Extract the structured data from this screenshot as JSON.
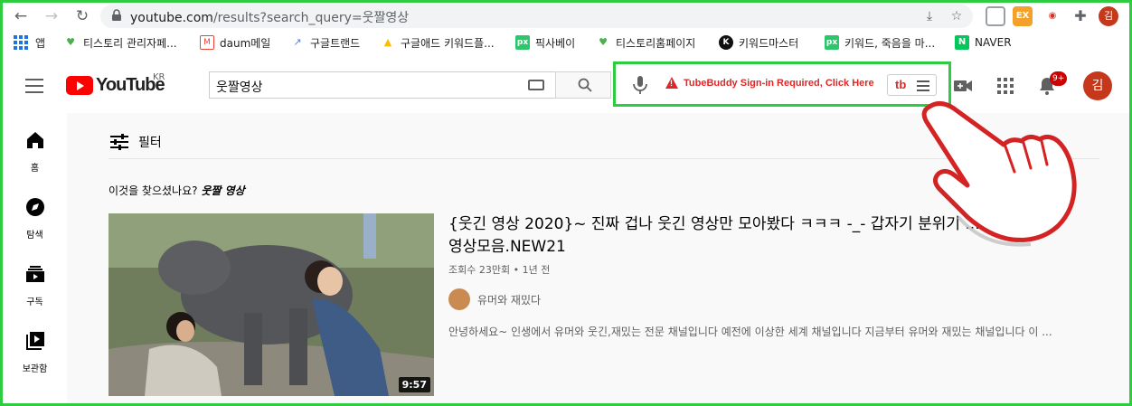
{
  "browser": {
    "url_host": "youtube.com",
    "url_path": "/results?search_query=웃짤영상",
    "extensions": [
      {
        "name": "ext-shield",
        "label": ""
      },
      {
        "name": "ext-ex",
        "label": "EX"
      },
      {
        "name": "ext-red",
        "label": ""
      }
    ],
    "profile_initial": "김"
  },
  "bookmarks": [
    {
      "label": "앱",
      "icon": "apps-grid-icon"
    },
    {
      "label": "티스토리 관리자페...",
      "icon": "tistory-heart-icon"
    },
    {
      "label": "daum메일",
      "icon": "gmail-icon"
    },
    {
      "label": "구글트랜드",
      "icon": "trends-icon"
    },
    {
      "label": "구글애드 키워드플...",
      "icon": "google-ads-icon"
    },
    {
      "label": "픽사베이",
      "icon": "pixabay-icon"
    },
    {
      "label": "티스토리홈페이지",
      "icon": "tistory-heart-icon"
    },
    {
      "label": "키워드마스터",
      "icon": "keyword-master-icon"
    },
    {
      "label": "키워드, 죽음을 마...",
      "icon": "pixabay-icon"
    },
    {
      "label": "NAVER",
      "icon": "naver-icon"
    }
  ],
  "header": {
    "logo_text": "YouTube",
    "country_code": "KR",
    "search_value": "웃짤영상",
    "tubebuddy_warning": "TubeBuddy Sign-in Required, Click Here",
    "tubebuddy_logo": "tb",
    "notification_count": "9+",
    "avatar_initial": "김"
  },
  "sidebar": {
    "items": [
      {
        "label": "홈",
        "icon": "home-icon"
      },
      {
        "label": "탐색",
        "icon": "compass-icon"
      },
      {
        "label": "구독",
        "icon": "subscriptions-icon"
      },
      {
        "label": "보관함",
        "icon": "library-icon"
      }
    ]
  },
  "results": {
    "filter_label": "필터",
    "suggest_prefix": "이것을 찾으셨나요?",
    "suggest_query": "웃짤 영상",
    "video": {
      "title": "{웃긴 영상 2020}~ 진짜 겁나 웃긴 영상만 모아봤다 ㅋㅋㅋ -_- 갑자기 분위기 ... 하는 웃긴 영상모음.NEW21",
      "meta": "조회수 23만회 • 1년 전",
      "channel": "유머와 재밌다",
      "description": "안녕하세요~ 인생에서 유머와 웃긴,재밌는 전문 채널입니다 예전에 이상한 세계 채널입니다 지금부터 유머와 재밌는 채널입니다 이 ...",
      "duration": "9:57"
    }
  },
  "colors": {
    "youtube_red": "#ff0000",
    "highlight_green": "#2ecc40",
    "tubebuddy_red": "#e02727"
  }
}
